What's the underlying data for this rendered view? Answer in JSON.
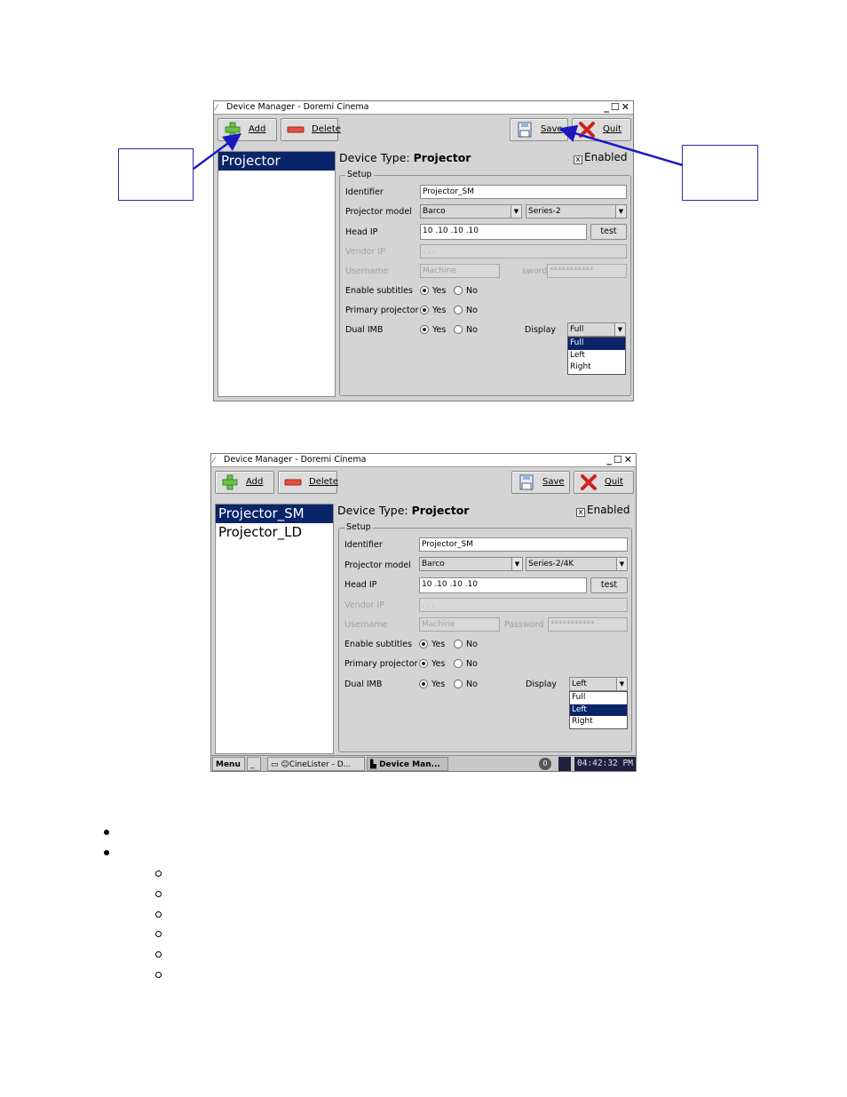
{
  "window": {
    "title": "Device Manager - Doremi Cinema",
    "controls": "_☐✕",
    "toolbar": {
      "add": "Add",
      "delete": "Delete",
      "save": "Save",
      "quit": "Quit"
    }
  },
  "screenshot1": {
    "devices": [
      "Projector"
    ],
    "device_type_label": "Device Type:",
    "device_type_value": "Projector",
    "enabled_label": "Enabled",
    "enabled_mark": "x",
    "setup_legend": "Setup",
    "fields": {
      "identifier_label": "Identifier",
      "identifier_value": "Projector_SM",
      "model_label": "Projector model",
      "model_value": "Barco",
      "series_value": "Series-2",
      "head_ip_label": "Head IP",
      "head_ip_value": "10 .10 .10 .10",
      "test_label": "test",
      "vendor_ip_label": "Vendor IP",
      "vendor_ip_value": ".   .   .",
      "username_label": "Username",
      "username_value": "Machine",
      "password_label": "sword",
      "password_value": "***********",
      "subtitles_label": "Enable subtitles",
      "primary_label": "Primary projector",
      "dual_label": "Dual IMB",
      "yes": "Yes",
      "no": "No",
      "display_label": "Display",
      "display_value": "Full"
    },
    "display_options": [
      "Full",
      "Left",
      "Right"
    ],
    "display_selected": "Full"
  },
  "screenshot2": {
    "devices": [
      "Projector_SM",
      "Projector_LD"
    ],
    "device_type_label": "Device Type:",
    "device_type_value": "Projector",
    "enabled_label": "Enabled",
    "enabled_mark": "x",
    "setup_legend": "Setup",
    "fields": {
      "identifier_label": "Identifier",
      "identifier_value": "Projector_SM",
      "model_label": "Projector model",
      "model_value": "Barco",
      "series_value": "Series-2/4K",
      "head_ip_label": "Head IP",
      "head_ip_value": "10 .10 .10 .10",
      "test_label": "test",
      "vendor_ip_label": "Vendor IP",
      "vendor_ip_value": ".   .   .",
      "username_label": "Username",
      "username_value": "Machine",
      "password_label": "Password",
      "password_value": "***********",
      "subtitles_label": "Enable subtitles",
      "primary_label": "Primary projector",
      "dual_label": "Dual IMB",
      "yes": "Yes",
      "no": "No",
      "display_label": "Display",
      "display_value": "Left"
    },
    "display_options": [
      "Full",
      "Left",
      "Right"
    ],
    "display_selected": "Left",
    "taskbar": {
      "menu": "Menu",
      "min": "_",
      "cinelister": "CineLister - D...",
      "device_man": "Device Man...",
      "badge": "0",
      "clock": "04:42:32 PM"
    }
  },
  "colors": {
    "selection": "#0a246a",
    "callout": "#2a2aa8",
    "window_bg": "#d4d4d4"
  },
  "icons": {
    "add": "plus-icon",
    "delete": "minus-icon",
    "save": "floppy-icon",
    "quit": "x-icon"
  }
}
